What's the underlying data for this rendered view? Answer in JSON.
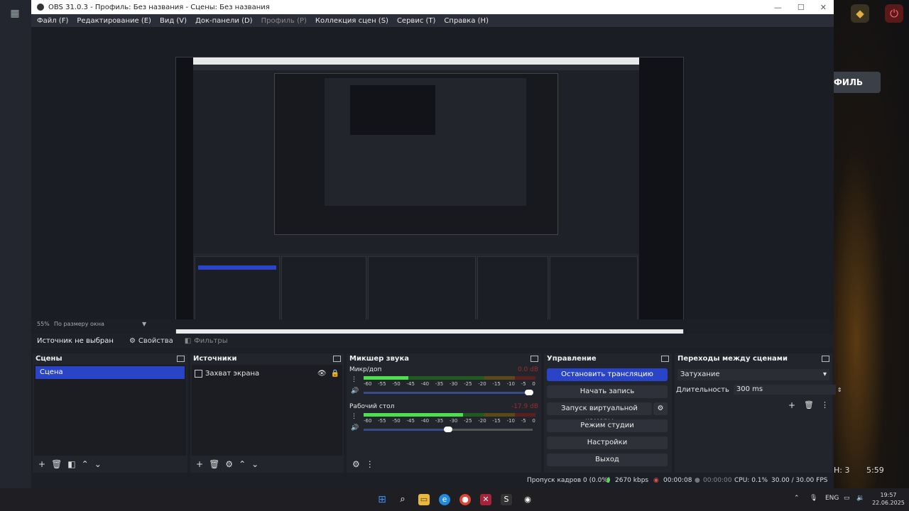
{
  "window": {
    "title": "OBS 31.0.3 - Профиль: Без названия - Сцены: Без названия"
  },
  "menu": [
    "Файл (F)",
    "Редактирование (E)",
    "Вид (V)",
    "Док-панели (D)",
    "Профиль (P)",
    "Коллекция сцен (S)",
    "Сервис (T)",
    "Справка (H)"
  ],
  "desktop": {
    "profile_button": "ФИЛЬ",
    "status_left": "Н: 3",
    "status_right": "5:59"
  },
  "zoom": {
    "percent": "55%",
    "mode": "По размеру окна"
  },
  "source_bar": {
    "label": "Источник не выбран",
    "properties": "Свойства",
    "filters": "Фильтры"
  },
  "scenes": {
    "title": "Сцены",
    "items": [
      "Сцена"
    ]
  },
  "sources": {
    "title": "Источники",
    "items": [
      "Захват экрана"
    ]
  },
  "mixer": {
    "title": "Микшер звука",
    "channels": [
      {
        "name": "Микр/доп",
        "db": "0.0 dB",
        "level": 0.26,
        "volume": 0.98
      },
      {
        "name": "Рабочий стол",
        "db": "-17.9 dB",
        "level": 0.58,
        "volume": 0.5
      }
    ],
    "ticks": [
      "-60",
      "-55",
      "-50",
      "-45",
      "-40",
      "-35",
      "-30",
      "-25",
      "-20",
      "-15",
      "-10",
      "-5",
      "0"
    ]
  },
  "controls": {
    "title": "Управление",
    "stop_stream": "Остановить трансляцию",
    "start_record": "Начать запись",
    "virtual_cam": "Запуск виртуальной камеры",
    "studio_mode": "Режим студии",
    "settings": "Настройки",
    "exit": "Выход"
  },
  "transitions": {
    "title": "Переходы между сценами",
    "selected": "Затухание",
    "duration_label": "Длительность",
    "duration_value": "300 ms"
  },
  "status": {
    "dropped": "Пропуск кадров 0 (0.0%)",
    "bitrate": "2670 kbps",
    "stream_time": "00:00:08",
    "record_time": "00:00:00",
    "cpu": "CPU: 0.1%",
    "fps": "30.00 / 30.00 FPS"
  },
  "taskbar": {
    "lang": "ENG",
    "time": "19:57",
    "date": "22.06.2025"
  },
  "colors": {
    "accent": "#2a44c8",
    "meter_green": "#4de04d"
  }
}
